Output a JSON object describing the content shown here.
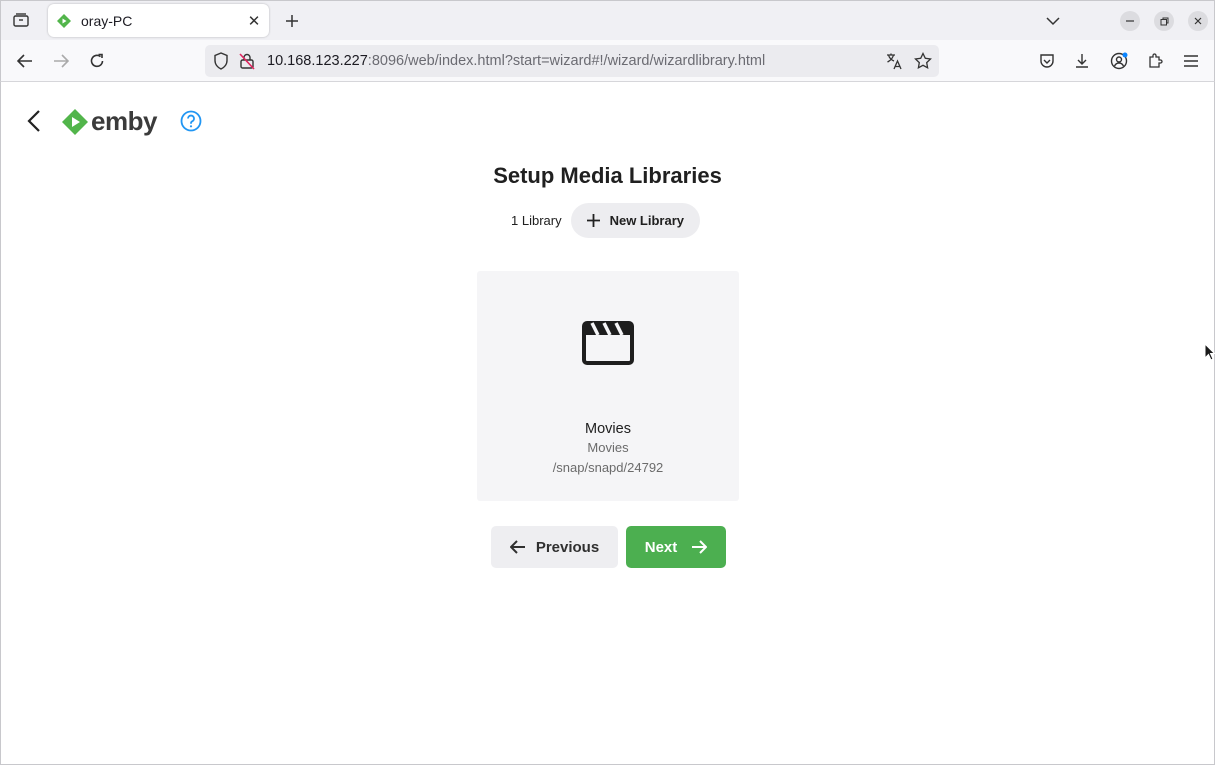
{
  "browser": {
    "tab_title": "oray-PC",
    "url_host": "10.168.123.227",
    "url_rest": ":8096/web/index.html?start=wizard#!/wizard/wizardlibrary.html"
  },
  "app": {
    "logo_text": "emby",
    "brand_color": "#52b54b"
  },
  "wizard": {
    "heading": "Setup Media Libraries",
    "library_count": "1 Library",
    "new_library_label": "New Library",
    "libraries": [
      {
        "name": "Movies",
        "type": "Movies",
        "path": "/snap/snapd/24792",
        "icon": "movie-clapper-icon"
      }
    ],
    "previous_label": "Previous",
    "next_label": "Next",
    "next_color": "#4caf50"
  }
}
